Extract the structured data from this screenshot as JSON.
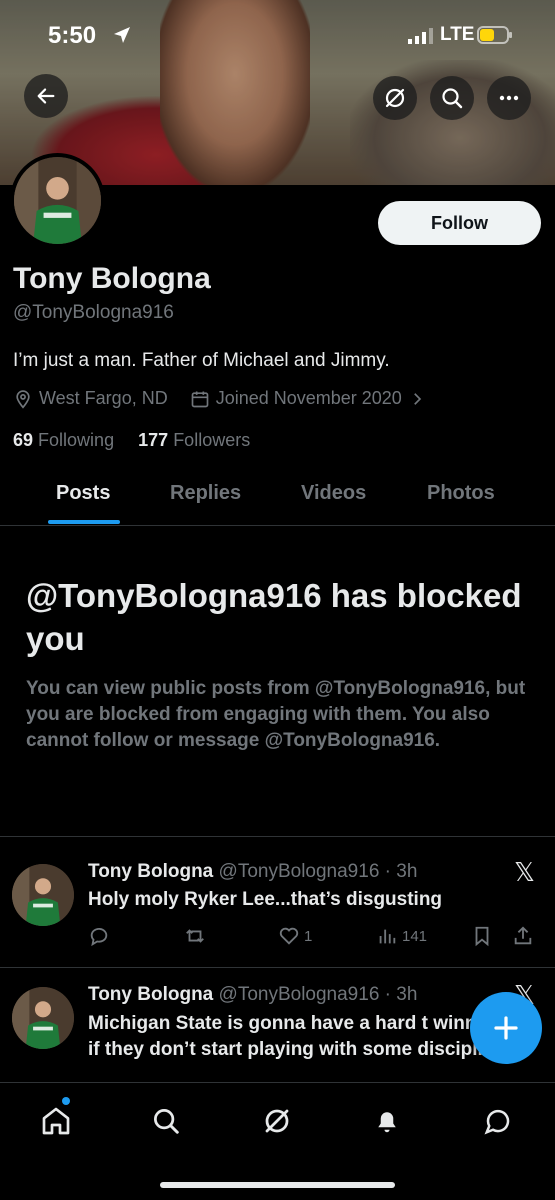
{
  "status_bar": {
    "time": "5:50",
    "network": "LTE"
  },
  "profile": {
    "display_name": "Tony Bologna",
    "handle": "@TonyBologna916",
    "bio": "I’m just a man. Father of Michael and Jimmy.",
    "location": "West Fargo, ND",
    "joined": "Joined November 2020",
    "following_count": "69",
    "following_label": "Following",
    "followers_count": "177",
    "followers_label": "Followers",
    "follow_button": "Follow"
  },
  "tabs": [
    {
      "label": "Posts",
      "active": true
    },
    {
      "label": "Replies",
      "active": false
    },
    {
      "label": "Videos",
      "active": false
    },
    {
      "label": "Photos",
      "active": false
    }
  ],
  "blocked": {
    "title": "@TonyBologna916 has blocked you",
    "body": "You can view public posts from @TonyBologna916, but you are blocked from engaging with them. You also cannot follow or message @TonyBologna916."
  },
  "tweets": [
    {
      "name": "Tony Bologna",
      "handle_time": "@TonyBologna916 · 3h",
      "text": "Holy moly Ryker Lee...that’s disgusting",
      "likes": "1",
      "views": "141"
    },
    {
      "name": "Tony Bologna",
      "handle_time": "@TonyBologna916 · 3h",
      "text": "Michigan State is gonna have a hard t winning if they don’t start playing with some discipline"
    }
  ],
  "icons": {
    "back": "arrow-left-icon",
    "grok": "grok-icon",
    "search": "search-icon",
    "more": "more-icon",
    "fab": "plus-icon",
    "nav": [
      "home-icon",
      "search-icon",
      "grok-icon",
      "bell-icon",
      "message-icon"
    ]
  },
  "colors": {
    "accent": "#1d9bf0",
    "background": "#000000",
    "muted": "#71767b",
    "text": "#e7e9ea"
  }
}
